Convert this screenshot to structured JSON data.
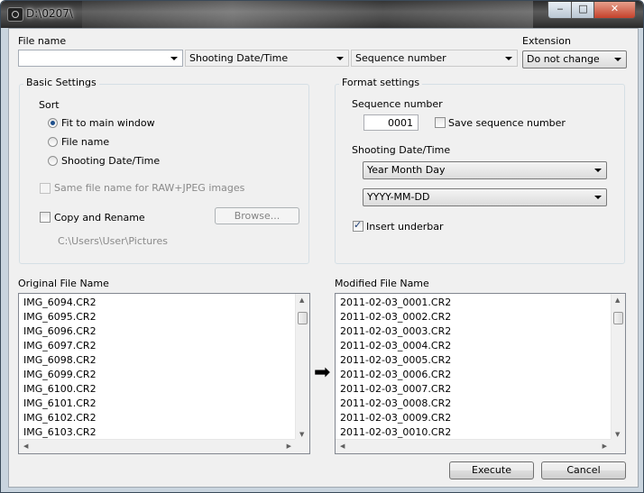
{
  "window": {
    "title": "D:\\0207\\"
  },
  "controls": {
    "minimize": "‒",
    "maximize": "□",
    "close": "✕"
  },
  "top": {
    "file_name_label": "File name",
    "file_name_value": "",
    "shooting_date_value": "Shooting Date/Time",
    "sequence_value": "Sequence number",
    "extension_label": "Extension",
    "extension_value": "Do not change"
  },
  "basic": {
    "title": "Basic Settings",
    "sort_label": "Sort",
    "sort_options": [
      "Fit to main window",
      "File name",
      "Shooting Date/Time"
    ],
    "sort_selected": "Fit to main window",
    "same_name_label": "Same file name for RAW+JPEG images",
    "copy_rename_label": "Copy and Rename",
    "browse_label": "Browse...",
    "path": "C:\\Users\\User\\Pictures"
  },
  "format": {
    "title": "Format settings",
    "sequence_label": "Sequence number",
    "sequence_value": "0001",
    "save_sequence_label": "Save sequence number",
    "shooting_label": "Shooting Date/Time",
    "date_order_value": "Year Month Day",
    "date_format_value": "YYYY-MM-DD",
    "insert_underbar_label": "Insert underbar",
    "insert_underbar_checked": true
  },
  "original": {
    "label": "Original File Name",
    "files": [
      "IMG_6094.CR2",
      "IMG_6095.CR2",
      "IMG_6096.CR2",
      "IMG_6097.CR2",
      "IMG_6098.CR2",
      "IMG_6099.CR2",
      "IMG_6100.CR2",
      "IMG_6101.CR2",
      "IMG_6102.CR2",
      "IMG_6103.CR2"
    ]
  },
  "modified": {
    "label": "Modified File Name",
    "files": [
      "2011-02-03_0001.CR2",
      "2011-02-03_0002.CR2",
      "2011-02-03_0003.CR2",
      "2011-02-03_0004.CR2",
      "2011-02-03_0005.CR2",
      "2011-02-03_0006.CR2",
      "2011-02-03_0007.CR2",
      "2011-02-03_0008.CR2",
      "2011-02-03_0009.CR2",
      "2011-02-03_0010.CR2"
    ]
  },
  "actions": {
    "execute": "Execute",
    "cancel": "Cancel"
  },
  "icons": {
    "arrow": "➡"
  }
}
